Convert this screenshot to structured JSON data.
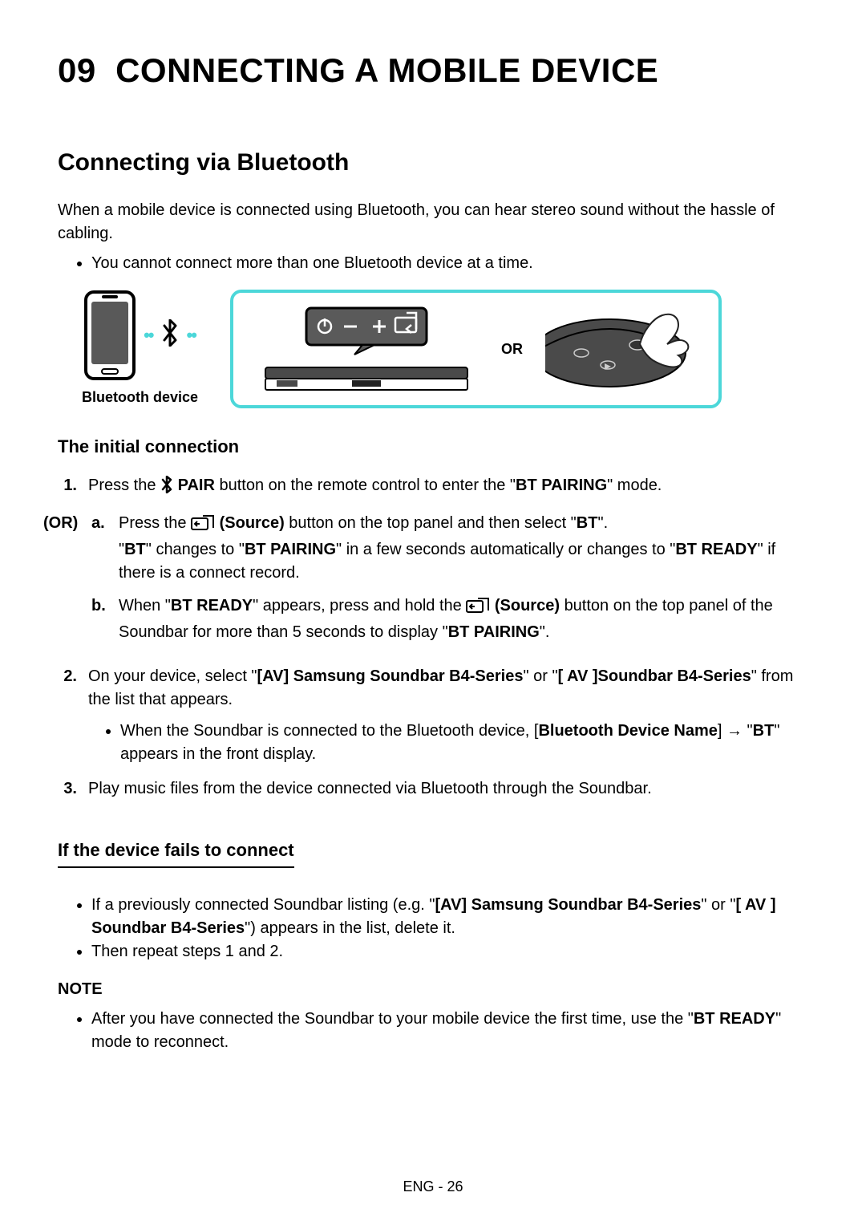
{
  "chapter_number": "09",
  "chapter_title": "CONNECTING A MOBILE DEVICE",
  "section_title": "Connecting via Bluetooth",
  "intro": "When a mobile device is connected using Bluetooth, you can hear stereo sound without the hassle of cabling.",
  "top_note": "You cannot connect more than one Bluetooth device at a time.",
  "bt_device_label": "Bluetooth device",
  "or_label": "OR",
  "h3_initial": "The initial connection",
  "step1_num": "1.",
  "step1_a": "Press the ",
  "step1_pair": "PAIR",
  "step1_b": " button on the remote control to enter the \"",
  "step1_pairing": "BT PAIRING",
  "step1_c": "\" mode.",
  "or_prefix": "(OR)",
  "sub_a_letter": "a.",
  "sub_a_1": "Press the ",
  "source_label": "(Source)",
  "sub_a_2": " button on the top panel and then select \"",
  "bt": "BT",
  "sub_a_3": "\".",
  "sub_a_line2_a": "\"",
  "sub_a_line2_b": "\" changes to \"",
  "sub_a_line2_c": "\" in a few seconds automatically or changes to \"",
  "bt_ready": "BT READY",
  "sub_a_line2_d": "\" if there is a connect record.",
  "sub_b_letter": "b.",
  "sub_b_1": "When \"",
  "sub_b_2": "\" appears, press and hold the ",
  "sub_b_3": " button on the top panel of the Soundbar for more than 5 seconds to display \"",
  "sub_b_4": "\".",
  "step2_num": "2.",
  "step2_a": "On your device, select \"",
  "av_samsung": "[AV] Samsung Soundbar B4-Series",
  "step2_b": "\" or \"",
  "av_space": "[ AV ]Soundbar B4-Series",
  "step2_c": "\" from the list that appears.",
  "step2_inner_a": "When the Soundbar is connected to the Bluetooth device, [",
  "bt_device_name": "Bluetooth Device Name",
  "step2_inner_b": "] → \"",
  "step2_inner_c": "\" appears in the front display.",
  "step3_num": "3.",
  "step3": "Play music files from the device connected via Bluetooth through the Soundbar.",
  "h3_fails": "If the device fails to connect",
  "fails_1a": "If a previously connected Soundbar listing (e.g. \"",
  "fails_1b": "\" or \"",
  "av_space2": "[ AV ] Soundbar B4-Series",
  "fails_1c": "\") appears in the list, delete it.",
  "fails_2": "Then repeat steps 1 and 2.",
  "note_heading": "NOTE",
  "note_1a": "After you have connected the Soundbar to your mobile device the first time, use the \"",
  "note_1b": "\" mode to reconnect.",
  "footer": "ENG - 26"
}
